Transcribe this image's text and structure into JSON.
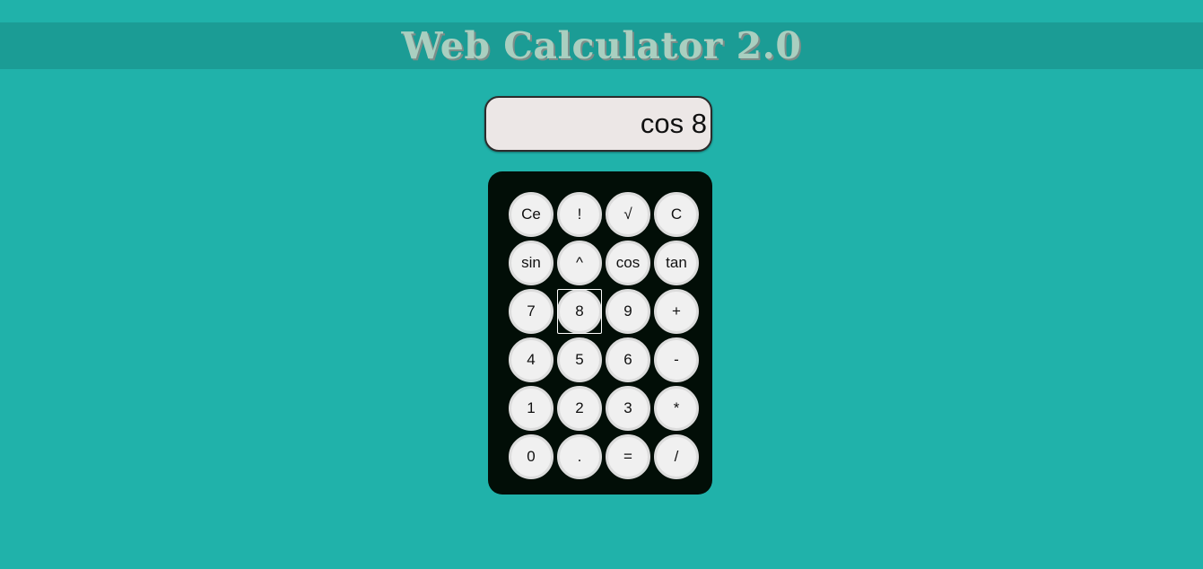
{
  "header": {
    "title": "Web Calculator 2.0"
  },
  "display": {
    "value": "cos 8"
  },
  "keypad": {
    "focused_key": "8",
    "rows": [
      [
        {
          "label": "Ce",
          "name": "clear-entry-button"
        },
        {
          "label": "!",
          "name": "factorial-button"
        },
        {
          "label": "√",
          "name": "square-root-button"
        },
        {
          "label": "C",
          "name": "clear-button"
        }
      ],
      [
        {
          "label": "sin",
          "name": "sin-button"
        },
        {
          "label": "^",
          "name": "power-button"
        },
        {
          "label": "cos",
          "name": "cos-button"
        },
        {
          "label": "tan",
          "name": "tan-button"
        }
      ],
      [
        {
          "label": "7",
          "name": "digit-7-button"
        },
        {
          "label": "8",
          "name": "digit-8-button"
        },
        {
          "label": "9",
          "name": "digit-9-button"
        },
        {
          "label": "+",
          "name": "add-button"
        }
      ],
      [
        {
          "label": "4",
          "name": "digit-4-button"
        },
        {
          "label": "5",
          "name": "digit-5-button"
        },
        {
          "label": "6",
          "name": "digit-6-button"
        },
        {
          "label": "-",
          "name": "subtract-button"
        }
      ],
      [
        {
          "label": "1",
          "name": "digit-1-button"
        },
        {
          "label": "2",
          "name": "digit-2-button"
        },
        {
          "label": "3",
          "name": "digit-3-button"
        },
        {
          "label": "*",
          "name": "multiply-button"
        }
      ],
      [
        {
          "label": "0",
          "name": "digit-0-button"
        },
        {
          "label": ".",
          "name": "decimal-point-button"
        },
        {
          "label": "=",
          "name": "equals-button"
        },
        {
          "label": "/",
          "name": "divide-button"
        }
      ]
    ]
  },
  "colors": {
    "background": "#20b2aa",
    "title_bar": "#1b9c95",
    "title_text": "#a9cfc0",
    "keypad": "#020e07",
    "key_face": "#f0f0f0",
    "display_face": "#ece7e6"
  }
}
